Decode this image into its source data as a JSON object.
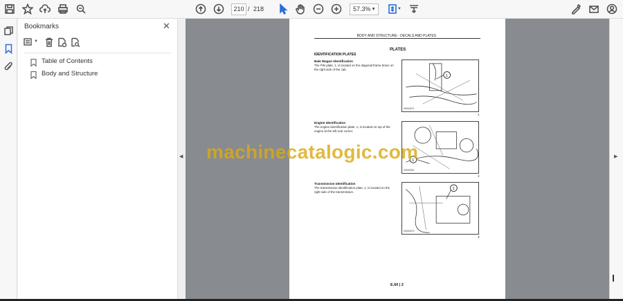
{
  "toolbar": {
    "current_page": "210",
    "page_separator": "/",
    "total_pages": "218",
    "zoom": "57.3%"
  },
  "bookmarks_panel": {
    "title": "Bookmarks",
    "items": [
      {
        "label": "Table of Contents"
      },
      {
        "label": "Body and Structure"
      }
    ]
  },
  "document": {
    "header": "BODY AND STRUCTURE - DECALS AND PLATES",
    "section_heading": "PLATES",
    "subsection": "IDENTIFICATION PLATES",
    "entries": [
      {
        "title": "Bale Wagon Identification",
        "text": "The PIN plate, 1, is located on the diagonal frame brace on the right side of the cab.",
        "fig_code": "00004071",
        "fig_number": "1"
      },
      {
        "title": "Engine Identification",
        "text": "The engine identification plate, 1, is located on top of the engine at the left rear corner.",
        "fig_code": "00002931",
        "fig_number": "2"
      },
      {
        "title": "Transmission Identification",
        "text": "The transmission identification plate, 1, is located on the right side of the transmission.",
        "fig_code": "00004072",
        "fig_number": "3"
      }
    ],
    "callout": "1",
    "footer": "E.60 | 2"
  },
  "watermark": "machinecatalogic.com",
  "icons": {
    "save": "save-icon",
    "bookmark": "bookmark-icon",
    "upload": "cloud-upload-icon",
    "print": "print-icon",
    "search": "search-zoom-icon",
    "prev": "page-up-icon",
    "next": "page-down-icon",
    "select": "select-cursor-icon",
    "hand": "hand-tool-icon",
    "zoom_out": "zoom-out-icon",
    "zoom_in": "zoom-in-icon",
    "fit": "fit-page-icon",
    "scroll": "scroll-mode-icon",
    "sign": "sign-icon",
    "mail": "mail-icon",
    "account": "account-icon"
  },
  "colors": {
    "viewer_bg": "#888b8f",
    "watermark": "#dcaa14",
    "toolbar_bg": "#f7f7f7"
  }
}
